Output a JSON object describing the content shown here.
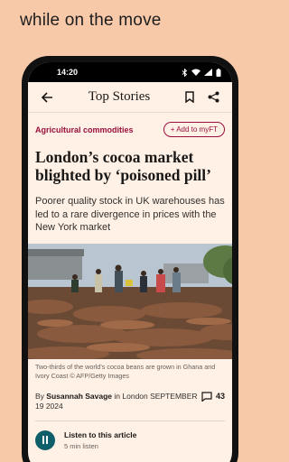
{
  "promo_text": "while on the move",
  "status": {
    "time": "14:20"
  },
  "appbar": {
    "title": "Top Stories"
  },
  "article": {
    "topic": "Agricultural commodities",
    "myft_label": "+ Add to myFT",
    "headline": "London’s cocoa market blighted by ‘poisoned pill’",
    "standfirst": "Poorer quality stock in UK warehouses has led to a rare divergence in prices with the New York market",
    "caption": "Two-thirds of the world’s cocoa beans are grown in Ghana and Ivory Coast © AFP/Getty Images",
    "byline_prefix": "By ",
    "author": "Susannah Savage",
    "byline_suffix": " in London SEPTEMBER 19 2024",
    "comment_count": "43"
  },
  "listen": {
    "title": "Listen to this article",
    "duration": "5 min listen"
  },
  "colors": {
    "background": "#f7c9a9",
    "screen": "#fff1e5",
    "accent": "#990f3d",
    "play": "#0f5f6b"
  }
}
